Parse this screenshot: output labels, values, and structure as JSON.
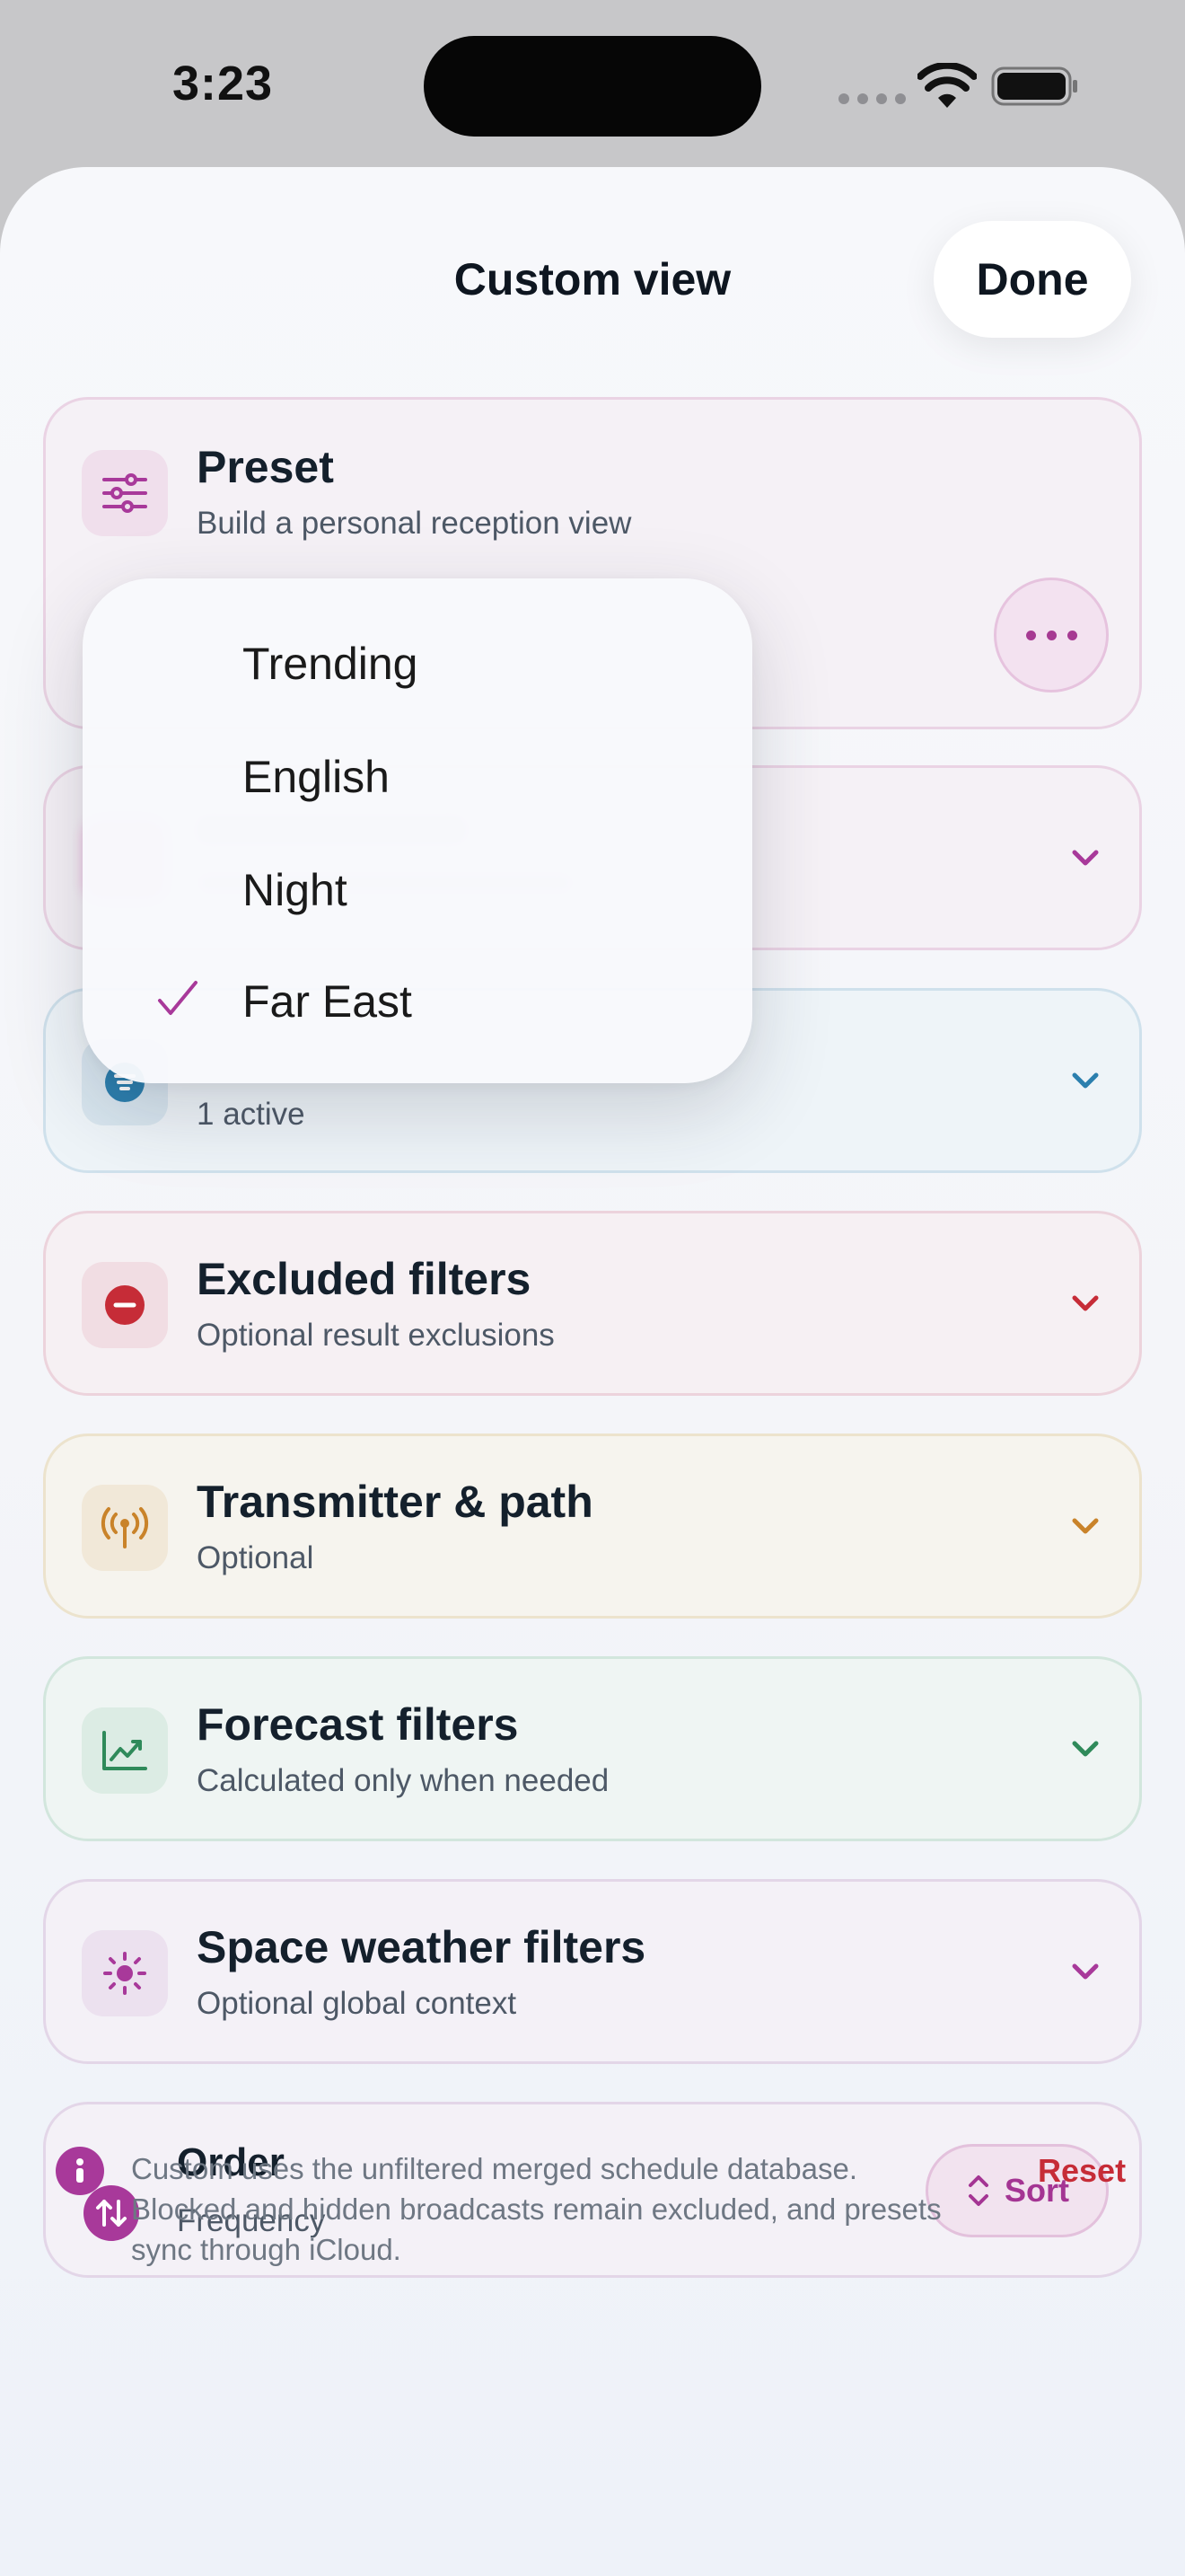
{
  "status": {
    "time": "3:23"
  },
  "header": {
    "title": "Custom view",
    "done_label": "Done"
  },
  "cards": {
    "preset": {
      "title": "Preset",
      "subtitle": "Build a personal reception view"
    },
    "blurred": {
      "title": "",
      "subtitle": ""
    },
    "included": {
      "title": "",
      "subtitle": "1 active"
    },
    "excluded": {
      "title": "Excluded filters",
      "subtitle": "Optional result exclusions"
    },
    "transmitter": {
      "title": "Transmitter & path",
      "subtitle": "Optional"
    },
    "forecast": {
      "title": "Forecast filters",
      "subtitle": "Calculated only when needed"
    },
    "space_weather": {
      "title": "Space weather filters",
      "subtitle": "Optional global context"
    },
    "order": {
      "title": "Order",
      "subtitle": "Frequency",
      "sort_label": "Sort"
    }
  },
  "preset_menu": {
    "items": [
      {
        "label": "Trending",
        "selected": false
      },
      {
        "label": "English",
        "selected": false
      },
      {
        "label": "Night",
        "selected": false
      },
      {
        "label": "Far East",
        "selected": true
      }
    ]
  },
  "footer": {
    "info_text": "Custom uses the unfiltered merged schedule database. Blocked and hidden broadcasts remain excluded, and presets sync through iCloud.",
    "reset_label": "Reset"
  },
  "colors": {
    "accent": "#a8399a",
    "blue": "#2b7fae",
    "red": "#c62c37",
    "orange": "#c9832a",
    "green": "#2f8a5a"
  },
  "icons": {
    "preset": "sliders-icon",
    "blurred": "hidden-icon",
    "included": "filter-list-icon",
    "excluded": "minus-circle-icon",
    "transmitter": "antenna-icon",
    "forecast": "chart-up-icon",
    "space_weather": "sun-icon",
    "order": "sort-arrows-icon",
    "info": "info-icon"
  }
}
